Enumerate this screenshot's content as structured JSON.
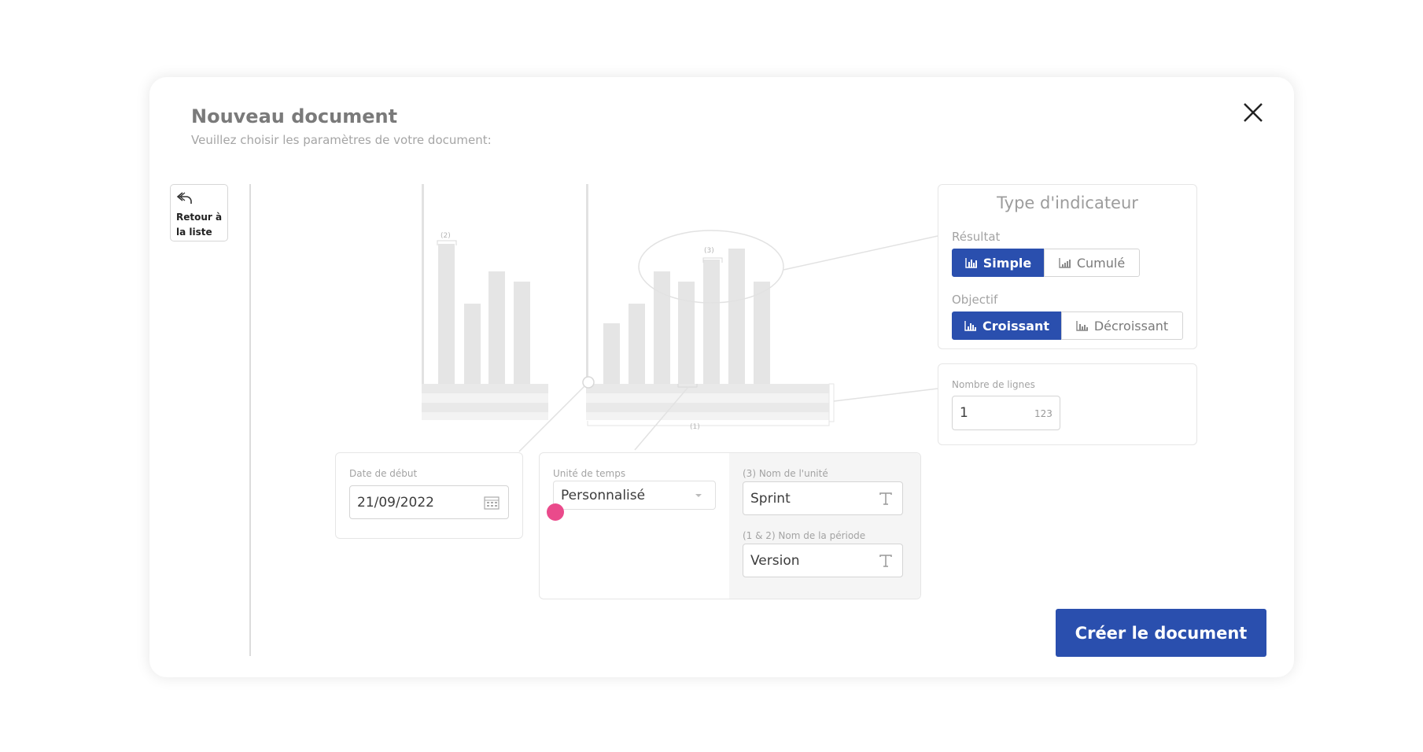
{
  "dialog": {
    "title": "Nouveau document",
    "subtitle": "Veuillez choisir les paramètres de votre document:"
  },
  "back_button": {
    "label": "Retour à\nla liste"
  },
  "preview": {
    "marker_2": "(2)",
    "marker_3": "(3)",
    "marker_1": "(1)"
  },
  "start_date": {
    "label": "Date de début",
    "value": "21/09/2022"
  },
  "time_unit": {
    "label": "Unité de temps",
    "selected": "Personnalisé"
  },
  "unit_name": {
    "label": "(3) Nom de l'unité",
    "value": "Sprint"
  },
  "period_name": {
    "label": "(1 & 2) Nom de la période",
    "value": "Version"
  },
  "indicator": {
    "title": "Type d'indicateur",
    "result_label": "Résultat",
    "result_options": [
      "Simple",
      "Cumulé"
    ],
    "result_selected": "Simple",
    "objective_label": "Objectif",
    "objective_options": [
      "Croissant",
      "Décroissant"
    ],
    "objective_selected": "Croissant"
  },
  "lines": {
    "label": "Nombre de lignes",
    "value": "1"
  },
  "create_button": {
    "label": "Créer le document"
  },
  "colors": {
    "primary": "#2a4fae",
    "accent_dot": "#ea4a8b",
    "placeholder_bars": "#e5e5e5"
  }
}
